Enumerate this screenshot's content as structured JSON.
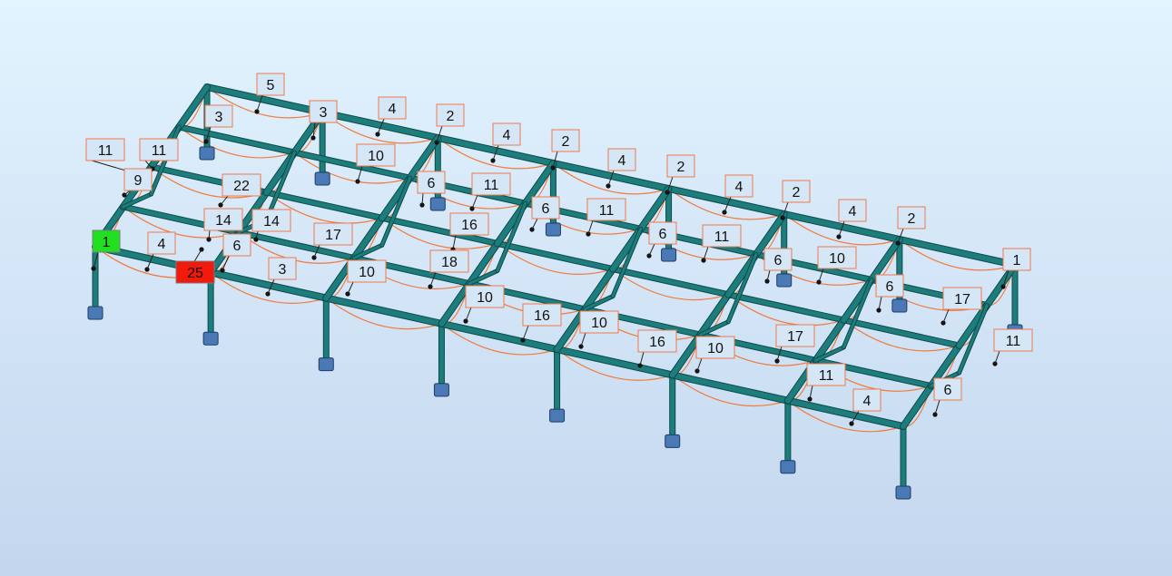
{
  "colors": {
    "member": "#1d7d7d",
    "member_edge": "#0e4a4a",
    "deflection": "#f27a3a",
    "support": "#4a79b5",
    "label_fill": "#d5e6f6",
    "label_border": "#f07a4a",
    "highlight_green": "#21e021",
    "highlight_red": "#f11a0c"
  },
  "node_labels": [
    {
      "text": "5",
      "style": "normal"
    },
    {
      "text": "3",
      "style": "normal"
    },
    {
      "text": "3",
      "style": "normal"
    },
    {
      "text": "4",
      "style": "normal"
    },
    {
      "text": "2",
      "style": "normal"
    },
    {
      "text": "4",
      "style": "normal"
    },
    {
      "text": "2",
      "style": "normal"
    },
    {
      "text": "4",
      "style": "normal"
    },
    {
      "text": "2",
      "style": "normal"
    },
    {
      "text": "4",
      "style": "normal"
    },
    {
      "text": "2",
      "style": "normal"
    },
    {
      "text": "4",
      "style": "normal"
    },
    {
      "text": "2",
      "style": "normal"
    },
    {
      "text": "11",
      "style": "normal"
    },
    {
      "text": "11",
      "style": "normal"
    },
    {
      "text": "9",
      "style": "normal"
    },
    {
      "text": "10",
      "style": "normal"
    },
    {
      "text": "6",
      "style": "normal"
    },
    {
      "text": "22",
      "style": "normal"
    },
    {
      "text": "11",
      "style": "normal"
    },
    {
      "text": "6",
      "style": "normal"
    },
    {
      "text": "11",
      "style": "normal"
    },
    {
      "text": "14",
      "style": "normal"
    },
    {
      "text": "14",
      "style": "normal"
    },
    {
      "text": "16",
      "style": "normal"
    },
    {
      "text": "6",
      "style": "normal"
    },
    {
      "text": "11",
      "style": "normal"
    },
    {
      "text": "17",
      "style": "normal"
    },
    {
      "text": "1",
      "style": "green"
    },
    {
      "text": "4",
      "style": "normal"
    },
    {
      "text": "6",
      "style": "normal"
    },
    {
      "text": "6",
      "style": "normal"
    },
    {
      "text": "10",
      "style": "normal"
    },
    {
      "text": "1",
      "style": "normal"
    },
    {
      "text": "25",
      "style": "red"
    },
    {
      "text": "3",
      "style": "normal"
    },
    {
      "text": "10",
      "style": "normal"
    },
    {
      "text": "18",
      "style": "normal"
    },
    {
      "text": "6",
      "style": "normal"
    },
    {
      "text": "10",
      "style": "normal"
    },
    {
      "text": "17",
      "style": "normal"
    },
    {
      "text": "16",
      "style": "normal"
    },
    {
      "text": "10",
      "style": "normal"
    },
    {
      "text": "16",
      "style": "normal"
    },
    {
      "text": "17",
      "style": "normal"
    },
    {
      "text": "11",
      "style": "normal"
    },
    {
      "text": "10",
      "style": "normal"
    },
    {
      "text": "11",
      "style": "normal"
    },
    {
      "text": "4",
      "style": "normal"
    },
    {
      "text": "6",
      "style": "normal"
    }
  ]
}
